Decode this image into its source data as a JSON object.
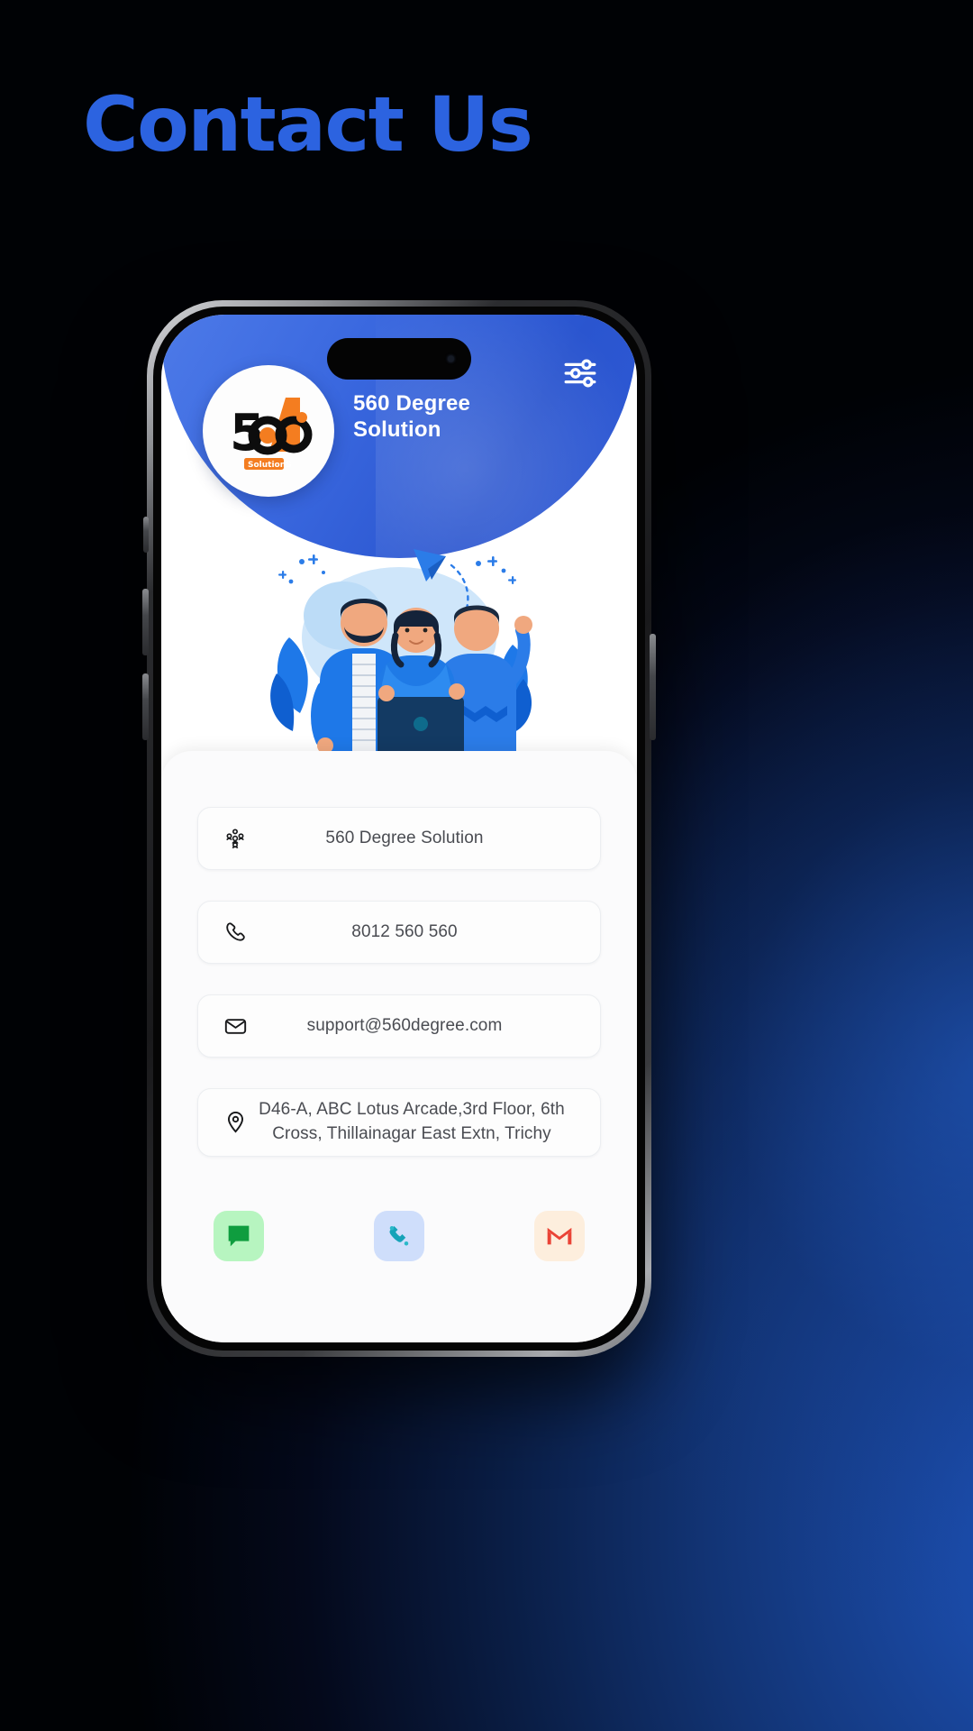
{
  "page": {
    "title": "Contact Us",
    "title_color": "#2c63e0",
    "background_colors": [
      "#000205",
      "#123475",
      "#1f57c4"
    ]
  },
  "phone": {
    "app_header": {
      "brand_name": "560 Degree Solution",
      "brand_color": "#3a68df",
      "logo_text": "560",
      "logo_subtext": "SolutionS",
      "logo_accent_color": "#f47d20",
      "settings_icon": "sliders-icon",
      "island_label": "dynamic-island"
    },
    "hero": {
      "alt": "team-illustration",
      "icon": "people-team-illustration"
    },
    "contacts": [
      {
        "icon": "group-people-icon",
        "label": "560  Degree Solution",
        "type": "company"
      },
      {
        "icon": "phone-icon",
        "label": "8012 560 560",
        "type": "phone"
      },
      {
        "icon": "envelope-icon",
        "label": "support@560degree.com",
        "type": "email"
      },
      {
        "icon": "location-pin-icon",
        "label": "D46-A, ABC Lotus Arcade,3rd Floor, 6th Cross, Thillainagar East Extn, Trichy",
        "type": "address"
      }
    ],
    "actions": [
      {
        "icon": "sms-chat-icon",
        "name": "sms",
        "bg": "#b7f5c0",
        "fg": "#0f9d3f"
      },
      {
        "icon": "phone-call-icon",
        "name": "call",
        "bg": "#cfdefb",
        "fg": "#16a3b8"
      },
      {
        "icon": "gmail-icon",
        "name": "gmail",
        "bg": "#fdeedd",
        "fg": "#ea4335"
      }
    ]
  }
}
